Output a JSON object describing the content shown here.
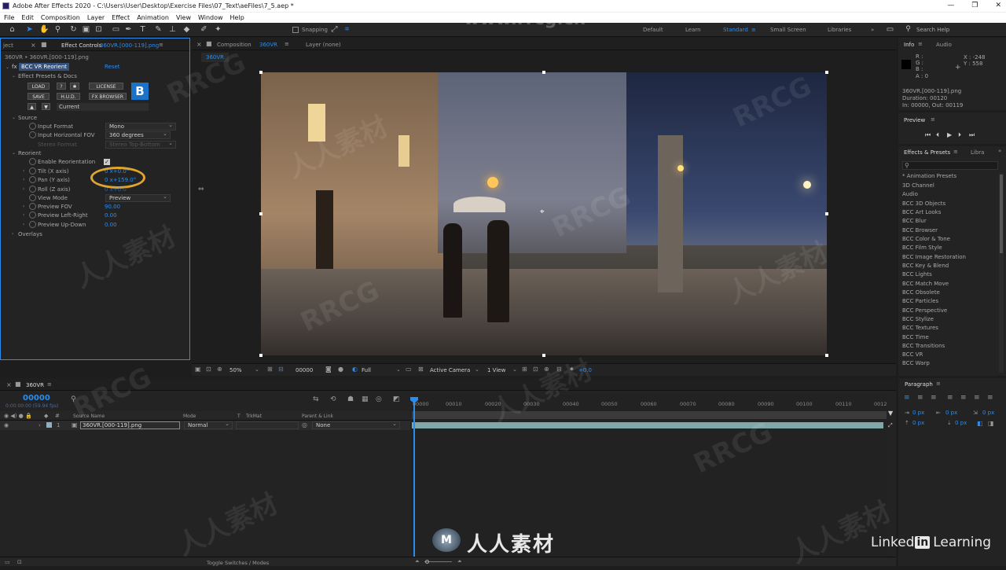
{
  "window": {
    "title": "Adobe After Effects 2020 - C:\\Users\\User\\Desktop\\Exercise Files\\07_Text\\aeFiles\\7_5.aep *"
  },
  "menu": [
    "File",
    "Edit",
    "Composition",
    "Layer",
    "Effect",
    "Animation",
    "View",
    "Window",
    "Help"
  ],
  "toolbar": {
    "snapping": "Snapping",
    "search_placeholder": "Search Help"
  },
  "workspaces": [
    "Default",
    "Learn",
    "Standard",
    "Small Screen",
    "Libraries"
  ],
  "effect_controls": {
    "left_tab": "ject",
    "tab": "Effect Controls",
    "tab_file": "360VR.[000-119].png",
    "breadcrumb": "360VR • 360VR.[000-119].png",
    "effect_name": "BCC VR Reorient",
    "reset": "Reset",
    "presets_group": "Effect Presets & Docs",
    "buttons": [
      "LOAD",
      "?",
      "LICENSE",
      "SAVE",
      "H.U.D.",
      "FX BROWSER"
    ],
    "current": "Current",
    "logo": "B",
    "source_group": "Source",
    "input_format_label": "Input Format",
    "input_format_value": "Mono",
    "input_fov_label": "Input Horizontal FOV",
    "input_fov_value": "360 degrees",
    "stereo_label": "Stereo Format",
    "stereo_value": "Stereo Top-Bottom",
    "reorient_group": "Reorient",
    "enable_label": "Enable Reorientation",
    "tilt_label": "Tilt (X axis)",
    "tilt_value": "0 x+0.0°",
    "pan_label": "Pan (Y axis)",
    "pan_value": "0 x+159.0°",
    "roll_label": "Roll (Z axis)",
    "roll_value": "0 x+0.0°",
    "view_mode_label": "View Mode",
    "view_mode_value": "Preview",
    "preview_fov_label": "Preview FOV",
    "preview_fov_value": "90.00",
    "preview_lr_label": "Preview Left-Right",
    "preview_lr_value": "0.00",
    "preview_ud_label": "Preview Up-Down",
    "preview_ud_value": "0.00",
    "overlays_group": "Overlays"
  },
  "composition": {
    "tab_label": "Composition",
    "tab_name": "360VR",
    "layer_tab": "Layer (none)",
    "subtab": "360VR",
    "zoom": "50%",
    "timecode": "00000",
    "resolution": "Full",
    "camera": "Active Camera",
    "views": "1 View",
    "exposure": "+0.0"
  },
  "info": {
    "tab": "Info",
    "audio_tab": "Audio",
    "r": "R :",
    "g": "G :",
    "b": "B :",
    "a": "A : 0",
    "x": "X : -248",
    "y": "Y : 558",
    "file": "360VR.[000-119].png",
    "duration": "Duration: 00120",
    "in_out": "In: 00000, Out: 00119"
  },
  "preview": {
    "tab": "Preview"
  },
  "effects_presets": {
    "tab": "Effects & Presets",
    "libraries_tab": "Libra",
    "items": [
      "* Animation Presets",
      "3D Channel",
      "Audio",
      "BCC 3D Objects",
      "BCC Art Looks",
      "BCC Blur",
      "BCC Browser",
      "BCC Color & Tone",
      "BCC Film Style",
      "BCC Image Restoration",
      "BCC Key & Blend",
      "BCC Lights",
      "BCC Match Move",
      "BCC Obsolete",
      "BCC Particles",
      "BCC Perspective",
      "BCC Stylize",
      "BCC Textures",
      "BCC Time",
      "BCC Transitions",
      "BCC VR",
      "BCC Warp"
    ]
  },
  "paragraph": {
    "tab": "Paragraph",
    "px": "0 px"
  },
  "timeline": {
    "tab": "360VR",
    "timecode": "00000",
    "timecode_sub": "0:00:00:00 (59.94 fps)",
    "col_source": "Source Name",
    "col_mode": "Mode",
    "col_t": "T",
    "col_trkmat": "TrkMat",
    "col_parent": "Parent & Link",
    "layer_num": "1",
    "layer_name": "360VR.[000-119].png",
    "layer_mode": "Normal",
    "layer_parent": "None",
    "ruler": [
      "00000",
      "00010",
      "00020",
      "00030",
      "00040",
      "00050",
      "00060",
      "00070",
      "00080",
      "00090",
      "00100",
      "00110",
      "0012"
    ],
    "toggle": "Toggle Switches / Modes"
  },
  "watermark": {
    "site": "www.rrcg.cn",
    "brand": "RRCG",
    "cn": "人人素材",
    "linkedin": "Linked",
    "linkedin_in": "in",
    "learning": "Learning"
  }
}
